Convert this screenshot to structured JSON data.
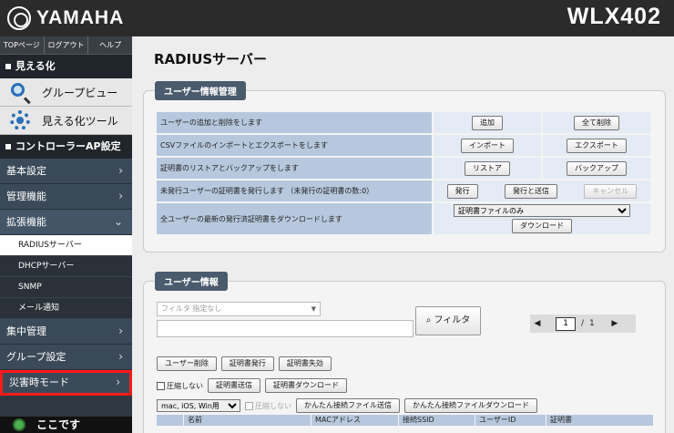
{
  "header": {
    "brand": "YAMAHA",
    "model": "WLX402"
  },
  "sidebar": {
    "topnav": [
      "TOPページ",
      "ログアウト",
      "ヘルプ"
    ],
    "viz_section": "見える化",
    "viz_items": [
      "グループビュー",
      "見える化ツール"
    ],
    "ctrl_section": "コントローラーAP設定",
    "menu": {
      "basic": "基本設定",
      "manage": "管理機能",
      "ext": "拡張機能",
      "radius": "RADIUSサーバー",
      "dhcp": "DHCPサーバー",
      "snmp": "SNMP",
      "mail": "メール通知",
      "central": "集中管理",
      "group": "グループ設定",
      "disaster": "災害時モード"
    },
    "here": "ここです"
  },
  "main": {
    "title": "RADIUSサーバー",
    "user_mgmt": {
      "tag": "ユーザー情報管理",
      "rows": [
        {
          "label": "ユーザーの追加と削除をします",
          "b1": "追加",
          "b2": "全て削除"
        },
        {
          "label": "CSVファイルのインポートとエクスポートをします",
          "b1": "インポート",
          "b2": "エクスポート"
        },
        {
          "label": "証明書のリストアとバックアップをします",
          "b1": "リストア",
          "b2": "バックアップ"
        },
        {
          "label": "未発行ユーザーの証明書を発行します （未発行の証明書の数:0）",
          "b1": "発行",
          "b2": "発行と送信",
          "b3": "キャンセル"
        },
        {
          "label": "全ユーザーの最新の発行済証明書をダウンロードします",
          "select": "証明書ファイルのみ",
          "b1": "ダウンロード"
        }
      ]
    },
    "user_info": {
      "tag": "ユーザー情報",
      "filter_placeholder": "フィルタ 指定なし",
      "filter_button": "フィルタ",
      "page_current": "1",
      "page_sep": "/",
      "page_total": "1",
      "btn_delete": "ユーザー削除",
      "btn_issue": "証明書発行",
      "btn_revoke": "証明書失効",
      "no_compress": "圧縮しない",
      "btn_send": "証明書送信",
      "btn_download": "証明書ダウンロード",
      "os_select": "mac, iOS, Win用",
      "no_compress2": "圧縮しない",
      "btn_easy_send": "かんたん接続ファイル送信",
      "btn_easy_download": "かんたん接続ファイルダウンロード",
      "columns": [
        "",
        "名前",
        "MACアドレス",
        "接続SSID",
        "ユーザーID",
        "証明書"
      ]
    }
  }
}
